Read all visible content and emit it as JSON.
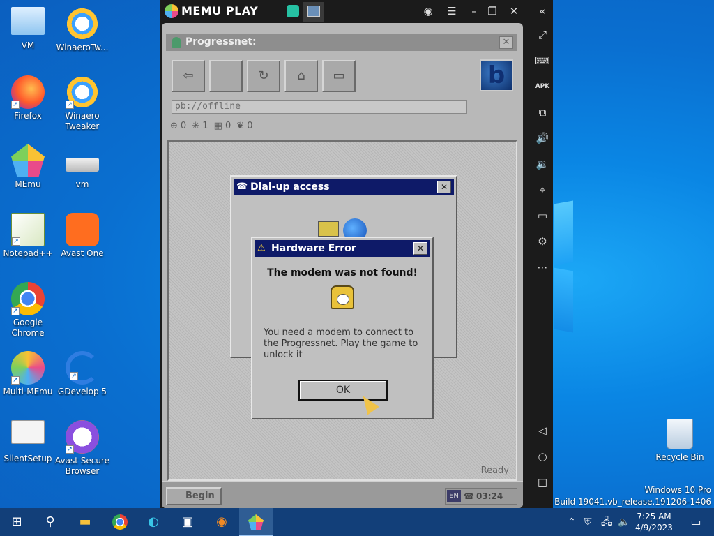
{
  "desktop": {
    "icons": [
      {
        "label": "VM",
        "icon": "computer-icon"
      },
      {
        "label": "WinaeroTw...",
        "icon": "winaero-icon"
      },
      {
        "label": "Firefox",
        "icon": "firefox-icon"
      },
      {
        "label": "Winaero Tweaker",
        "icon": "winaero-icon"
      },
      {
        "label": "MEmu",
        "icon": "memu-icon"
      },
      {
        "label": "vm",
        "icon": "drive-icon"
      },
      {
        "label": "Notepad++",
        "icon": "notepadpp-icon"
      },
      {
        "label": "Avast One",
        "icon": "avast-icon"
      },
      {
        "label": "Google Chrome",
        "icon": "chrome-icon"
      },
      {
        "label": "Multi-MEmu",
        "icon": "multimemu-icon"
      },
      {
        "label": "GDevelop 5",
        "icon": "gdevelop-icon"
      },
      {
        "label": "SilentSetup",
        "icon": "setup-icon"
      },
      {
        "label": "Avast Secure Browser",
        "icon": "avast-browser-icon"
      }
    ],
    "recycle_bin": "Recycle Bin",
    "watermark_line1": "Windows 10 Pro",
    "watermark_line2": "Build 19041.vb_release.191206-1406"
  },
  "memu": {
    "brand": "MEMU PLAY",
    "title_controls": [
      "user-icon",
      "menu-icon",
      "minimize-icon",
      "restore-icon",
      "close-icon",
      "collapse-icon"
    ],
    "sidebar_icons": [
      "fullscreen-icon",
      "keyboard-icon",
      "apk-icon",
      "add-window-icon",
      "volume-up-icon",
      "volume-down-icon",
      "location-icon",
      "folder-icon",
      "settings-icon",
      "more-icon",
      "back-icon",
      "home-icon",
      "recents-icon"
    ],
    "apk_label": "APK"
  },
  "app": {
    "title": "Progressnet:",
    "address": "pb://offline",
    "stats": [
      "0",
      "1",
      "0",
      "0"
    ],
    "status": "Ready",
    "begin": "Begin",
    "lang": "EN",
    "time": "03:24 AM"
  },
  "dialup": {
    "title": "Dial-up access"
  },
  "error": {
    "title": "Hardware Error",
    "heading": "The modem was not found!",
    "body": "You need a modem to connect to the Progressnet. Play the game to unlock it",
    "ok": "OK"
  },
  "taskbar": {
    "clock_time": "7:25 AM",
    "clock_date": "4/9/2023"
  }
}
